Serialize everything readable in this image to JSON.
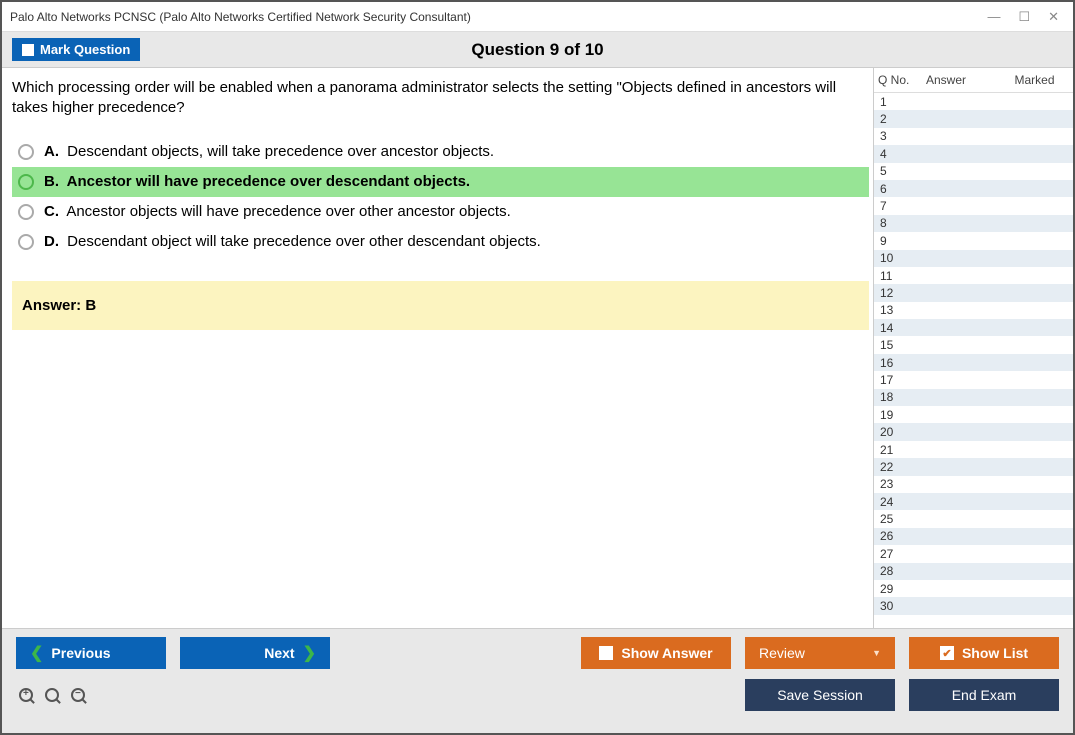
{
  "window": {
    "title": "Palo Alto Networks PCNSC (Palo Alto Networks Certified Network Security Consultant)"
  },
  "header": {
    "mark_question": "Mark Question",
    "question_counter": "Question 9 of 10"
  },
  "question": {
    "text": "Which processing order will be enabled when a panorama administrator selects the setting \"Objects defined in ancestors will takes higher precedence?",
    "options": [
      {
        "letter": "A.",
        "text": "Descendant objects, will take precedence over ancestor objects.",
        "highlight": false
      },
      {
        "letter": "B.",
        "text": "Ancestor will have precedence over descendant objects.",
        "highlight": true
      },
      {
        "letter": "C.",
        "text": "Ancestor objects will have precedence over other ancestor objects.",
        "highlight": false
      },
      {
        "letter": "D.",
        "text": "Descendant object will take precedence over other descendant objects.",
        "highlight": false
      }
    ],
    "answer_label": "Answer: B"
  },
  "side": {
    "headers": {
      "qno": "Q No.",
      "answer": "Answer",
      "marked": "Marked"
    },
    "total_rows": 30
  },
  "footer": {
    "previous": "Previous",
    "next": "Next",
    "show_answer": "Show Answer",
    "review": "Review",
    "show_list": "Show List",
    "save_session": "Save Session",
    "end_exam": "End Exam"
  }
}
